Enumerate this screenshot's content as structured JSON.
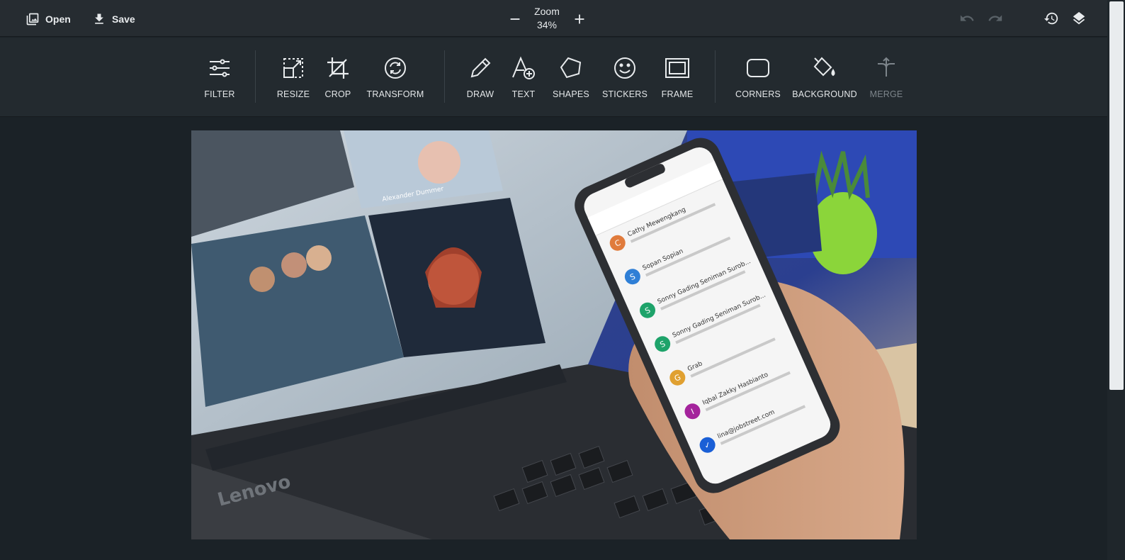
{
  "topbar": {
    "open_label": "Open",
    "save_label": "Save",
    "zoom_label": "Zoom",
    "zoom_value": "34%"
  },
  "tools": [
    {
      "label": "FILTER",
      "icon": "sliders-icon"
    },
    {
      "label": "RESIZE",
      "icon": "resize-icon"
    },
    {
      "label": "CROP",
      "icon": "crop-icon"
    },
    {
      "label": "TRANSFORM",
      "icon": "rotate-icon"
    },
    {
      "label": "DRAW",
      "icon": "pencil-icon"
    },
    {
      "label": "TEXT",
      "icon": "text-add-icon"
    },
    {
      "label": "SHAPES",
      "icon": "pentagon-icon"
    },
    {
      "label": "STICKERS",
      "icon": "smiley-icon"
    },
    {
      "label": "FRAME",
      "icon": "frame-icon"
    },
    {
      "label": "CORNERS",
      "icon": "rounded-square-icon"
    },
    {
      "label": "BACKGROUND",
      "icon": "paint-bucket-icon"
    },
    {
      "label": "MERGE",
      "icon": "merge-icon",
      "disabled": true
    }
  ],
  "photo": {
    "laptop_brand": "Lenovo",
    "caption_name": "Alexander Dummer",
    "emails": [
      {
        "initial": "C",
        "sender": "Cathy Mewengkang",
        "color": "#e07b3c"
      },
      {
        "initial": "S",
        "sender": "Sopan Sopian",
        "color": "#2f7fd6"
      },
      {
        "initial": "S",
        "sender": "Sonny Gading Seniman Surob...",
        "color": "#1ea36a"
      },
      {
        "initial": "S",
        "sender": "Sonny Gading Seniman Surob...",
        "color": "#1ea36a"
      },
      {
        "initial": "G",
        "sender": "Grab",
        "color": "#e0a030"
      },
      {
        "initial": "I",
        "sender": "Iqbal Zakky Hasbianto",
        "color": "#a4239c"
      },
      {
        "initial": "✓",
        "sender": "lina@jobstreet.com",
        "color": "#1a5fd6"
      }
    ]
  },
  "colors": {
    "topbar_bg": "#262c31",
    "toolbar_bg": "#232a2f",
    "canvas_bg": "#1b2227",
    "text": "#e6e9eb",
    "disabled_text": "#7d858b"
  }
}
